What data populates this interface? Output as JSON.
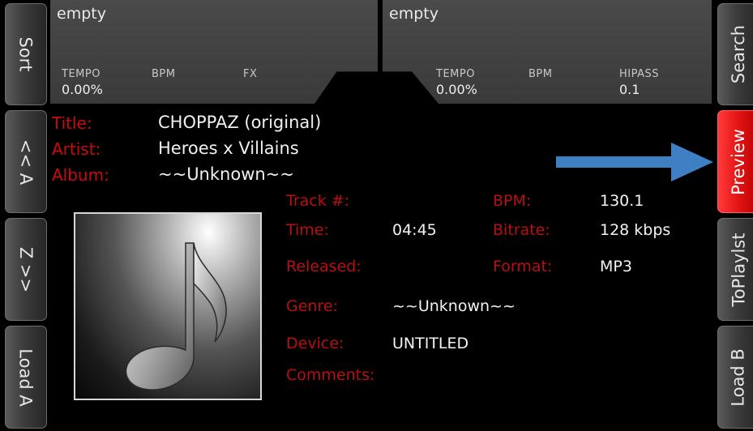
{
  "left_buttons": {
    "sort": "Sort",
    "a_to_z": "<< A",
    "z_to_a": "Z >>",
    "load_a": "Load A"
  },
  "right_buttons": {
    "search": "Search",
    "preview": "Preview",
    "toplaylist": "ToPlaylst",
    "load_b": "Load B"
  },
  "deck_a": {
    "name": "empty",
    "tempo_label": "TEMPO",
    "tempo_value": "0.00%",
    "bpm_label": "BPM",
    "fx_label": "FX"
  },
  "deck_b": {
    "name": "empty",
    "tempo_label": "TEMPO",
    "tempo_value": "0.00%",
    "bpm_label": "BPM",
    "hipass_label": "HIPASS",
    "hipass_value": "0.1"
  },
  "track": {
    "title_label": "Title:",
    "title": "CHOPPAZ (original)",
    "artist_label": "Artist:",
    "artist": "Heroes x Villains",
    "album_label": "Album:",
    "album": "~~Unknown~~"
  },
  "details": {
    "track_num_label": "Track #:",
    "track_num": "",
    "bpm_label": "BPM:",
    "bpm": "130.1",
    "time_label": "Time:",
    "time": "04:45",
    "bitrate_label": "Bitrate:",
    "bitrate": "128 kbps",
    "released_label": "Released:",
    "released": "",
    "format_label": "Format:",
    "format": "MP3",
    "genre_label": "Genre:",
    "genre": "~~Unknown~~",
    "device_label": "Device:",
    "device": "UNTITLED",
    "comments_label": "Comments:",
    "comments": ""
  },
  "colors": {
    "label_red": "#cc0a0a",
    "active_red": "#e31414",
    "arrow_blue": "#3f7fc4"
  },
  "icons": {
    "album_art": "music-note-icon",
    "annotation": "arrow-right-icon"
  }
}
